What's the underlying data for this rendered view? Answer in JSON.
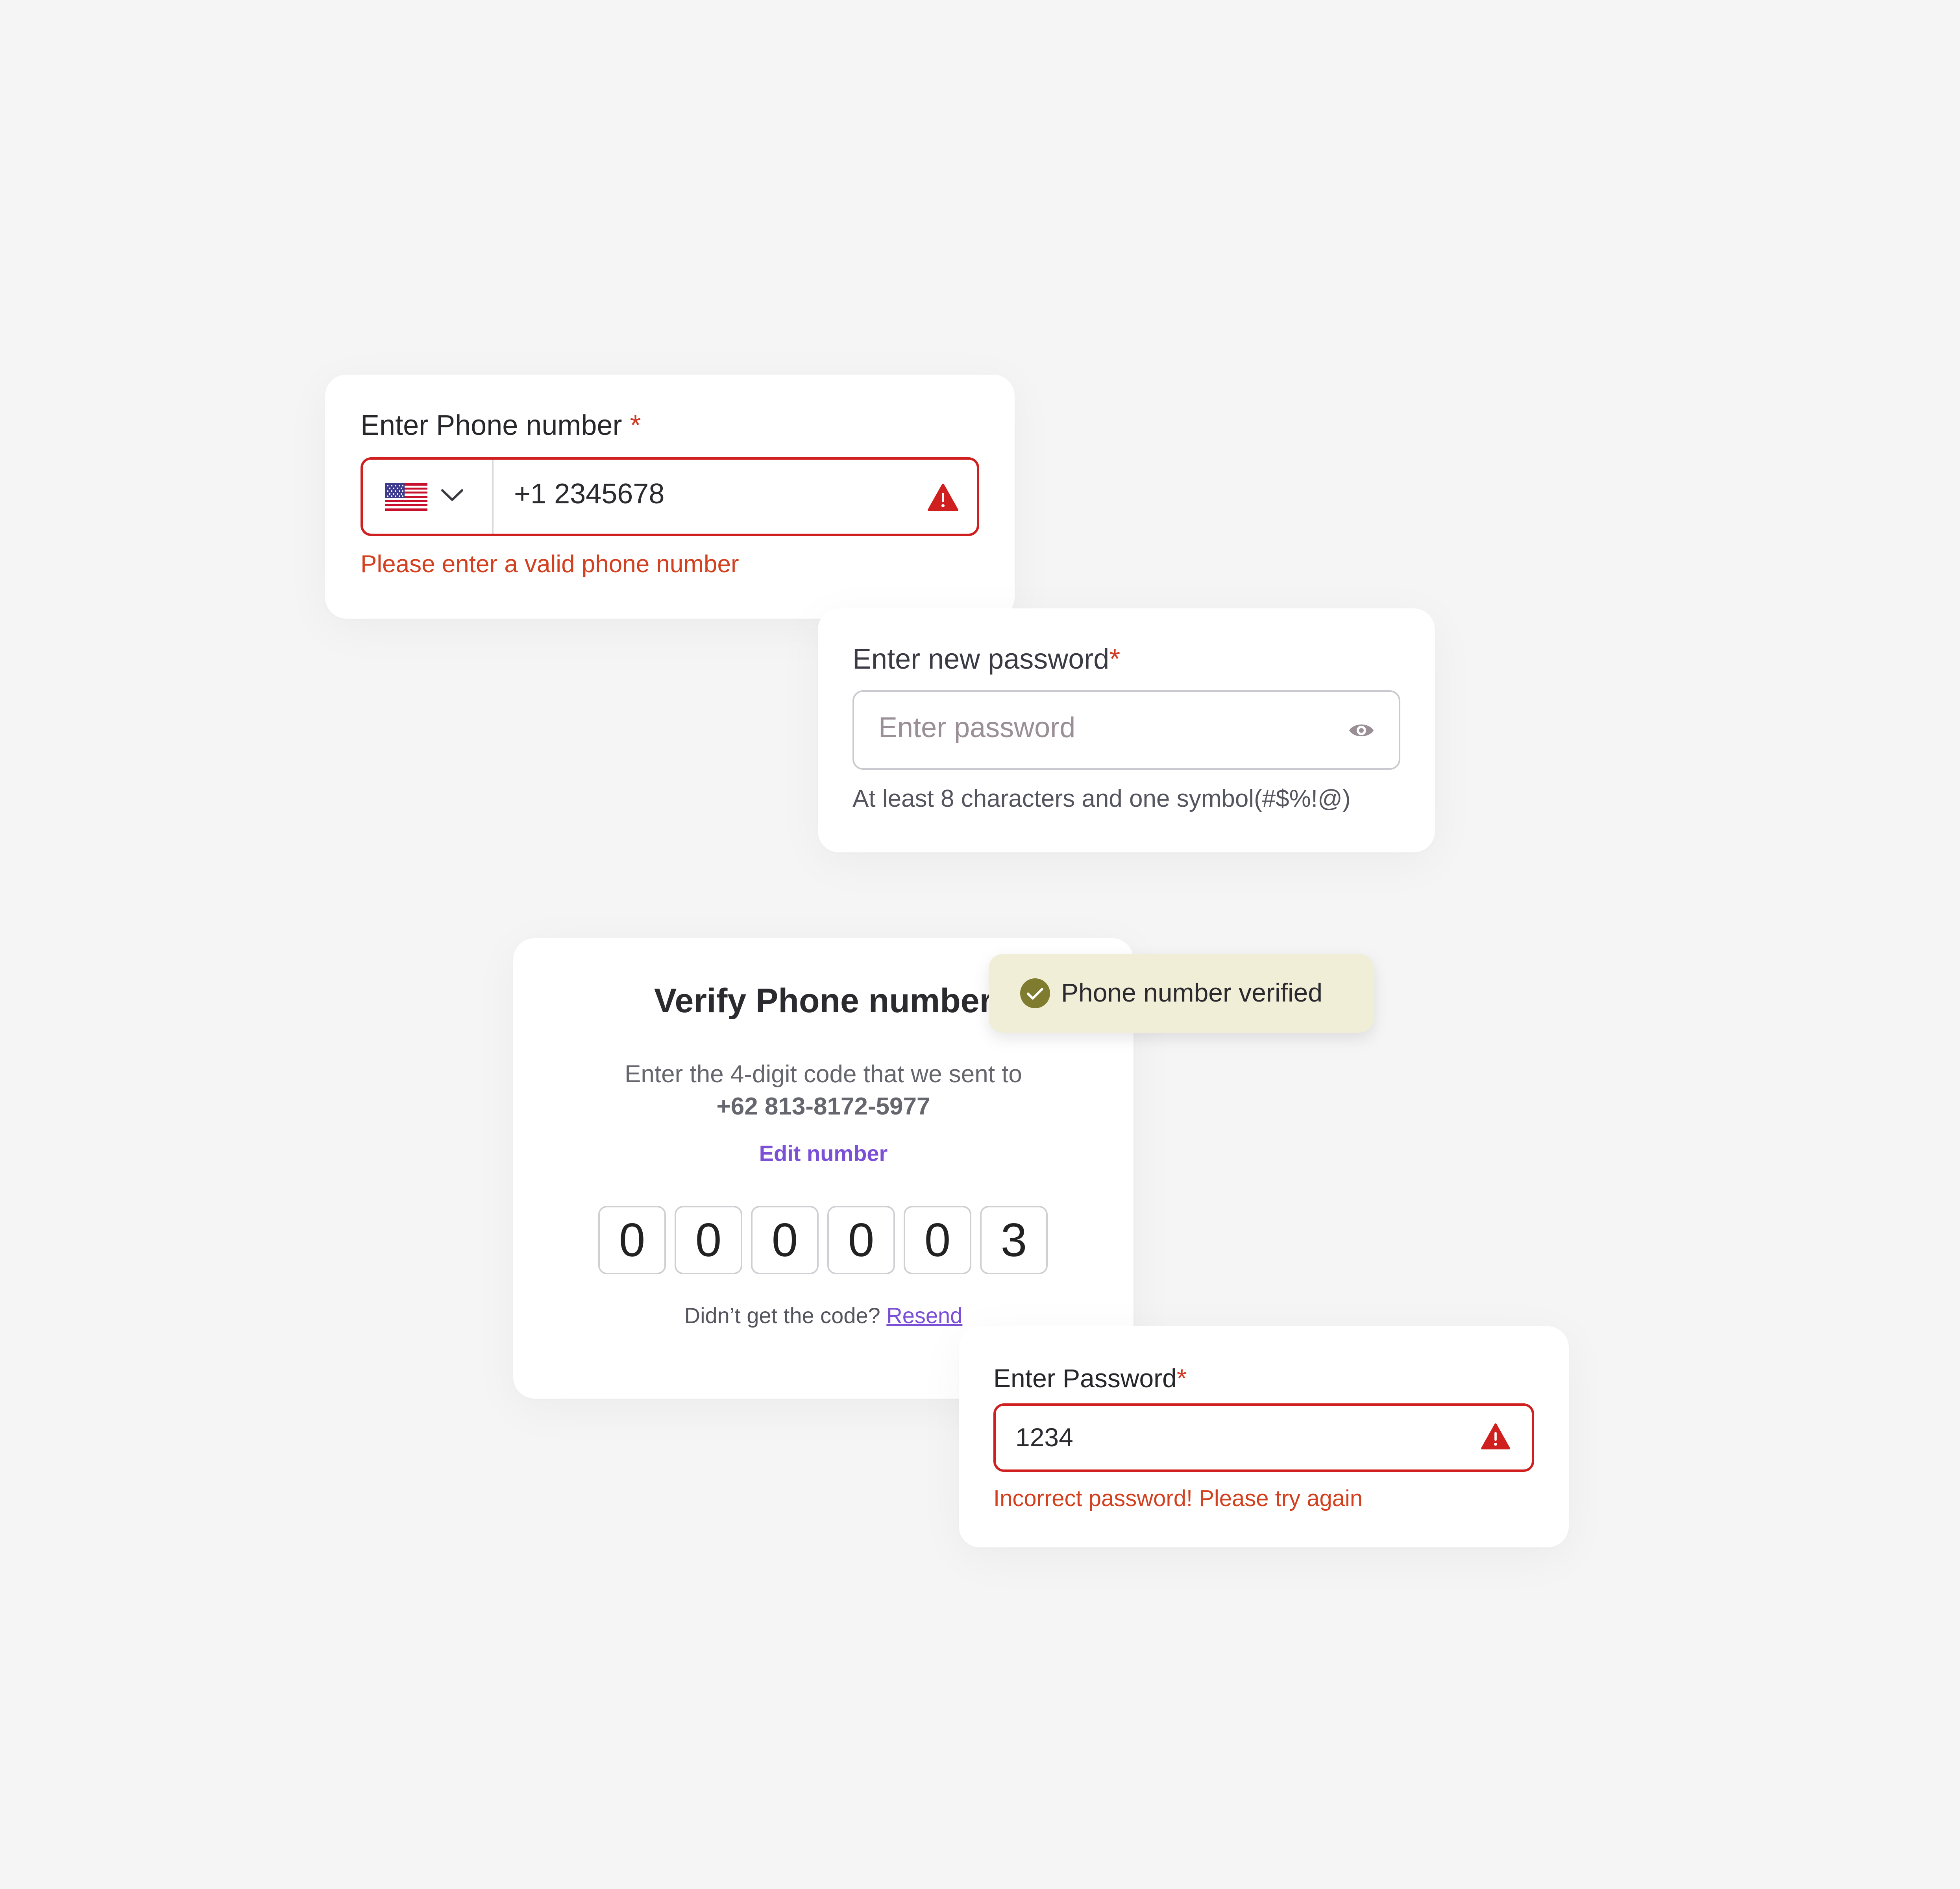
{
  "phone_field": {
    "label": "Enter Phone number",
    "required_mark": "*",
    "country_flag": "us-flag-icon",
    "value": "+1 2345678",
    "error_message": "Please enter a valid phone number"
  },
  "new_password": {
    "label": "Enter new password",
    "required_mark": "*",
    "placeholder": "Enter password",
    "hint": "At least 8 characters and one symbol(#$%!@)"
  },
  "verify": {
    "title": "Verify Phone number",
    "description": "Enter the 4-digit code that we sent to",
    "phone_number": "+62 813-8172-5977",
    "edit_link": "Edit number",
    "digits": [
      "0",
      "0",
      "0",
      "0",
      "0",
      "3"
    ],
    "resend_prompt": "Didn’t get the code?",
    "resend_link": "Resend"
  },
  "toast": {
    "message": "Phone number verified"
  },
  "password": {
    "label": "Enter Password",
    "required_mark": "*",
    "value": "1234",
    "error_message": "Incorrect password! Please try again"
  },
  "colors": {
    "error": "#cf1f1f",
    "error_text": "#d2401f",
    "link": "#7b4fd6",
    "toast_bg": "#f1eed7",
    "toast_check": "#7f7b2f",
    "background": "#f5f5f5"
  }
}
